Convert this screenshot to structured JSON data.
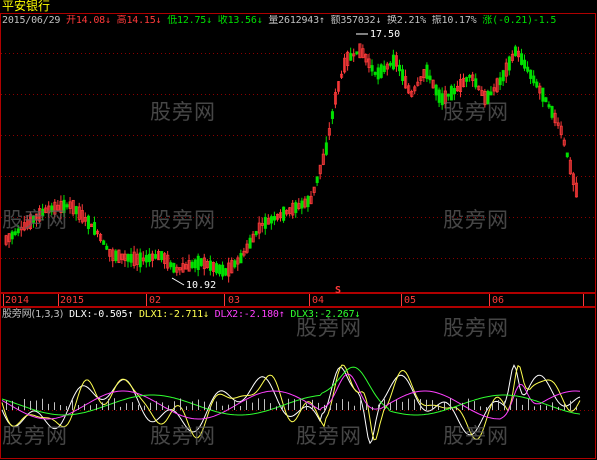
{
  "stock": {
    "name": "平安银行"
  },
  "header": {
    "date": "2015/06/29",
    "open_label": "开",
    "open": "14.08",
    "high_label": "高",
    "high": "14.15",
    "low_label": "低",
    "low": "12.75",
    "close_label": "收",
    "close": "13.56",
    "volume_label": "量",
    "volume": "2612943",
    "amount_label": "额",
    "amount": "357032",
    "turnover_label": "换",
    "turnover": "2.21%",
    "amplitude_label": "振",
    "amplitude": "10.17%",
    "change_label": "涨",
    "change": "(-0.21)",
    "change_pct": "-1.5"
  },
  "annotations": {
    "high_marker": "17.50",
    "low_marker": "10.92",
    "s_marker": "S"
  },
  "time_axis": [
    "2014",
    "2015",
    "02",
    "03",
    "04",
    "05",
    "06"
  ],
  "indicator": {
    "name": "股旁网(1,3,3)",
    "dlx_label": "DLX:",
    "dlx": "-0.505",
    "dlx1_label": "DLX1:",
    "dlx1": "-2.711",
    "dlx2_label": "DLX2:",
    "dlx2": "-2.180",
    "dlx3_label": "DLX3:",
    "dlx3": "-2.267"
  },
  "watermark": "股旁网",
  "colors": {
    "up": "#ff3a3a",
    "down": "#00e000",
    "dlx": "#ffffff",
    "dlx1": "#ffff50",
    "dlx2": "#ff40ff",
    "dlx3": "#30ff30",
    "text_label": "#c0c0c0"
  }
}
